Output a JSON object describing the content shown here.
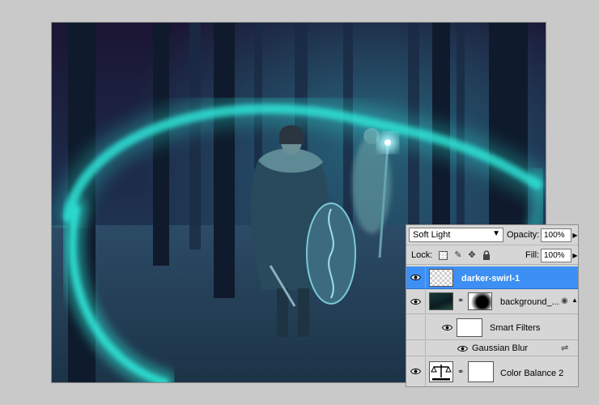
{
  "layers_panel": {
    "blend_mode": "Soft Light",
    "opacity_label": "Opacity:",
    "opacity_value": "100%",
    "lock_label": "Lock:",
    "fill_label": "Fill:",
    "fill_value": "100%",
    "layers": [
      {
        "name": "darker-swirl-1",
        "selected": true,
        "visible": true
      },
      {
        "name": "background_...",
        "selected": false,
        "visible": true
      },
      {
        "name": "Smart Filters",
        "selected": false,
        "visible": true
      },
      {
        "name": "Gaussian Blur",
        "selected": false,
        "visible": true
      },
      {
        "name": "Color Balance 2",
        "selected": false,
        "visible": true
      }
    ]
  },
  "colors": {
    "selection": "#3d8ff3",
    "panel_bg": "#d6d6d6",
    "app_bg": "#c9c9c9",
    "swirl": "#2fe6d8"
  }
}
